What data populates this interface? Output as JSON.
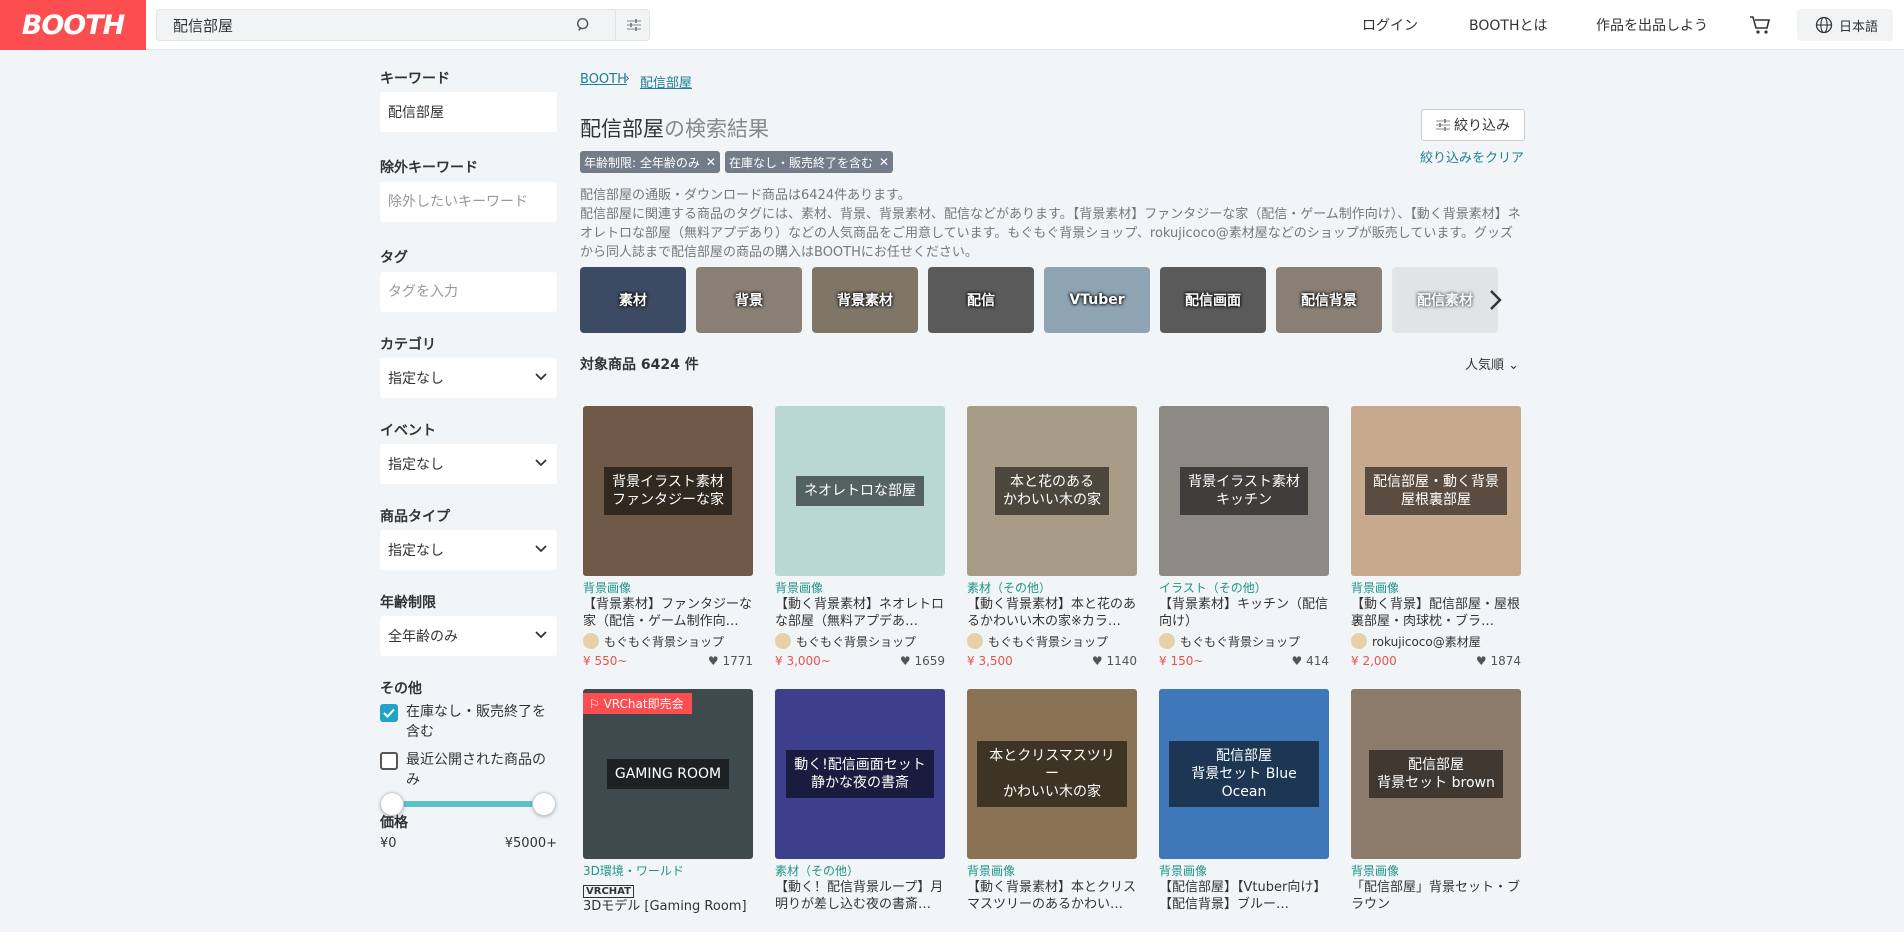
{
  "header": {
    "logo": "BOOTH",
    "search_value": "配信部屋",
    "nav": [
      "ログイン",
      "BOOTHとは",
      "作品を出品しよう"
    ],
    "language": "日本語"
  },
  "sidebar": {
    "keyword_label": "キーワード",
    "keyword_value": "配信部屋",
    "exclude_label": "除外キーワード",
    "exclude_placeholder": "除外したいキーワード",
    "tag_label": "タグ",
    "tag_placeholder": "タグを入力",
    "category_label": "カテゴリ",
    "category_value": "指定なし",
    "event_label": "イベント",
    "event_value": "指定なし",
    "type_label": "商品タイプ",
    "type_value": "指定なし",
    "age_label": "年齢制限",
    "age_value": "全年齢のみ",
    "other_label": "その他",
    "check1": "在庫なし・販売終了を含む",
    "check1_checked": true,
    "check2": "最近公開された商品のみ",
    "check2_checked": false,
    "price_label": "価格",
    "price_min": "¥0",
    "price_max": "¥5000+"
  },
  "main": {
    "breadcrumb": [
      "BOOTH",
      "配信部屋"
    ],
    "title_keyword": "配信部屋",
    "title_suffix": "の検索結果",
    "narrow_button": "絞り込み",
    "clear_link": "絞り込みをクリア",
    "chips": [
      "年齢制限: 全年齢のみ",
      "在庫なし・販売終了を含む"
    ],
    "description": "配信部屋の通販・ダウンロード商品は6424件あります。\n配信部屋に関連する商品のタグには、素材、背景、背景素材、配信などがあります。【背景素材】ファンタジーな家（配信・ゲーム制作向け）、【動く背景素材】ネオレトロな部屋（無料アプデあり）などの人気商品をご用意しています。もぐもぐ背景ショップ、rokujicoco@素材屋などのショップが販売しています。グッズから同人誌まで配信部屋の商品の購入はBOOTHにお任せください。",
    "tags": [
      "素材",
      "背景",
      "背景素材",
      "配信",
      "VTuber",
      "配信画面",
      "配信背景",
      "配信素材"
    ],
    "count": "対象商品 6424 件",
    "sort": "人気順"
  },
  "items": [
    {
      "cat": "背景画像",
      "name": "【背景素材】ファンタジーな家（配信・ゲーム制作向…",
      "shop": "もぐもぐ背景ショップ",
      "price": "¥ 550~",
      "likes": "1771",
      "overlay": "背景イラスト素材\nファンタジーな家",
      "color": "#6e5a46"
    },
    {
      "cat": "背景画像",
      "name": "【動く背景素材】ネオレトロな部屋（無料アプデあ…",
      "shop": "もぐもぐ背景ショップ",
      "price": "¥ 3,000~",
      "likes": "1659",
      "overlay": "ネオレトロな部屋",
      "color": "#b9d8d4"
    },
    {
      "cat": "素材（その他）",
      "name": "【動く背景素材】本と花のあるかわいい木の家※カラ…",
      "shop": "もぐもぐ背景ショップ",
      "price": "¥ 3,500",
      "likes": "1140",
      "overlay": "本と花のある\nかわいい木の家",
      "color": "#a89c86"
    },
    {
      "cat": "イラスト（その他）",
      "name": "【背景素材】キッチン（配信向け）",
      "shop": "もぐもぐ背景ショップ",
      "price": "¥ 150~",
      "likes": "414",
      "overlay": "背景イラスト素材\nキッチン",
      "color": "#8d8a85"
    },
    {
      "cat": "背景画像",
      "name": "【動く背景】配信部屋・屋根裏部屋・肉球枕・ブラ…",
      "shop": "rokujicoco@素材屋",
      "price": "¥ 2,000",
      "likes": "1874",
      "overlay": "配信部屋・動く背景\n屋根裏部屋",
      "color": "#c7a98e"
    },
    {
      "cat": "3D環境・ワールド",
      "name": "3Dモデル [Gaming Room]",
      "shop": "",
      "price": "",
      "likes": "",
      "overlay": "GAMING ROOM",
      "color": "#3f4a4c",
      "badge": "VRChat即売会",
      "vrchat": "VRCHAT"
    },
    {
      "cat": "素材（その他）",
      "name": "【動く！配信背景ループ】月明りが差し込む夜の書斎…",
      "shop": "",
      "price": "",
      "likes": "",
      "overlay": "動く!配信画面セット\n静かな夜の書斎",
      "color": "#3b3f8c"
    },
    {
      "cat": "背景画像",
      "name": "【動く背景素材】本とクリスマスツリーのあるかわい…",
      "shop": "",
      "price": "",
      "likes": "",
      "overlay": "本とクリスマスツリー\nかわいい木の家",
      "color": "#8a7354"
    },
    {
      "cat": "背景画像",
      "name": "【配信部屋】【Vtuber向け】【配信背景】ブルー…",
      "shop": "",
      "price": "",
      "likes": "",
      "overlay": "配信部屋\n背景セット Blue Ocean",
      "color": "#3f78b8"
    },
    {
      "cat": "背景画像",
      "name": "「配信部屋」背景セット・ブラウン",
      "shop": "",
      "price": "",
      "likes": "",
      "overlay": "配信部屋\n背景セット brown",
      "color": "#8c7a6a"
    }
  ]
}
